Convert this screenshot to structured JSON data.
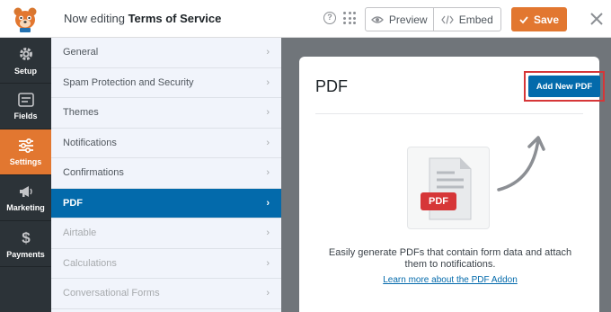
{
  "header": {
    "editing_prefix": "Now editing",
    "form_name": "Terms of Service",
    "help_icon": "question-circle-icon",
    "preview_label": "Preview",
    "embed_label": "Embed",
    "save_label": "Save",
    "accent": "#e27730"
  },
  "leftnav": {
    "items": [
      {
        "label": "Setup",
        "icon": "gear-icon"
      },
      {
        "label": "Fields",
        "icon": "fields-icon"
      },
      {
        "label": "Settings",
        "icon": "sliders-icon",
        "active": true
      },
      {
        "label": "Marketing",
        "icon": "megaphone-icon"
      },
      {
        "label": "Payments",
        "icon": "dollar-icon"
      }
    ],
    "active_color": "#e27730",
    "background": "#2c3338"
  },
  "settings": {
    "items": [
      {
        "label": "General"
      },
      {
        "label": "Spam Protection and Security"
      },
      {
        "label": "Themes"
      },
      {
        "label": "Notifications"
      },
      {
        "label": "Confirmations"
      },
      {
        "label": "PDF",
        "active": true
      },
      {
        "label": "Airtable",
        "disabled": true
      },
      {
        "label": "Calculations",
        "disabled": true
      },
      {
        "label": "Conversational Forms",
        "disabled": true
      }
    ],
    "active_color": "#036aab"
  },
  "panel": {
    "title": "PDF",
    "add_button": "Add New PDF",
    "pdf_badge": "PDF",
    "description": "Easily generate PDFs that contain form data and attach them to notifications.",
    "learn_more": "Learn more about the PDF Addon",
    "highlight_color": "#d63638"
  }
}
